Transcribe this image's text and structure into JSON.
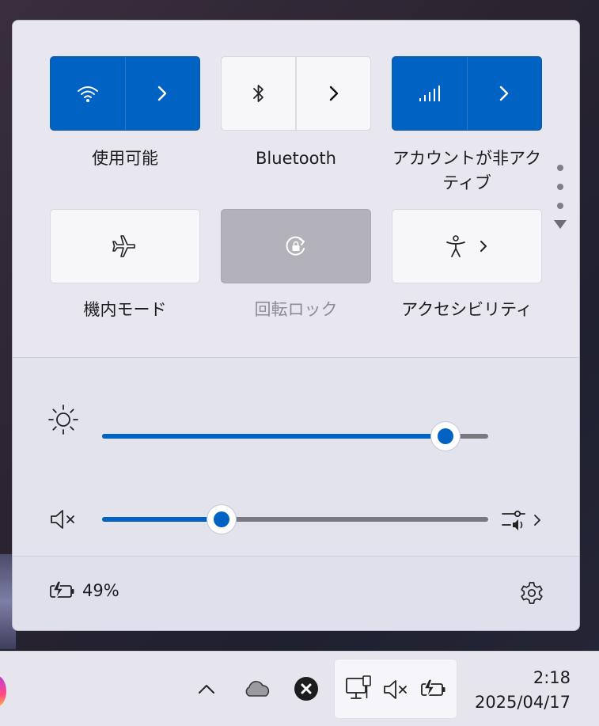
{
  "tiles": {
    "wifi": {
      "label": "使用可能",
      "state": "on",
      "icon": "wifi-icon"
    },
    "bluetooth": {
      "label": "Bluetooth",
      "state": "off",
      "icon": "bluetooth-icon"
    },
    "cellular": {
      "label_line1": "アカウントが非アク",
      "label_line2": "ティブ",
      "state": "on",
      "icon": "cellular-signal-icon"
    },
    "airplane": {
      "label": "機内モード",
      "state": "off",
      "icon": "airplane-icon"
    },
    "rotation_lock": {
      "label": "回転ロック",
      "state": "disabled",
      "icon": "rotation-lock-icon"
    },
    "accessibility": {
      "label": "アクセシビリティ",
      "state": "off",
      "icon": "accessibility-icon"
    }
  },
  "brightness": {
    "level": 0.89,
    "icon": "brightness-sun-icon"
  },
  "volume": {
    "level": 0.31,
    "icon": "speaker-muted-icon"
  },
  "battery": {
    "percent": "49%",
    "icon": "battery-charging-icon"
  },
  "taskbar": {
    "time": "2:18",
    "date": "2025/04/17",
    "icons": [
      "chevron-up-icon",
      "onedrive-cloud-icon",
      "close-circle-icon",
      "network-wired-icon",
      "speaker-muted-icon",
      "battery-charging-icon"
    ]
  },
  "colors": {
    "accent": "#0063c4",
    "panel": "#e7e6ef"
  }
}
